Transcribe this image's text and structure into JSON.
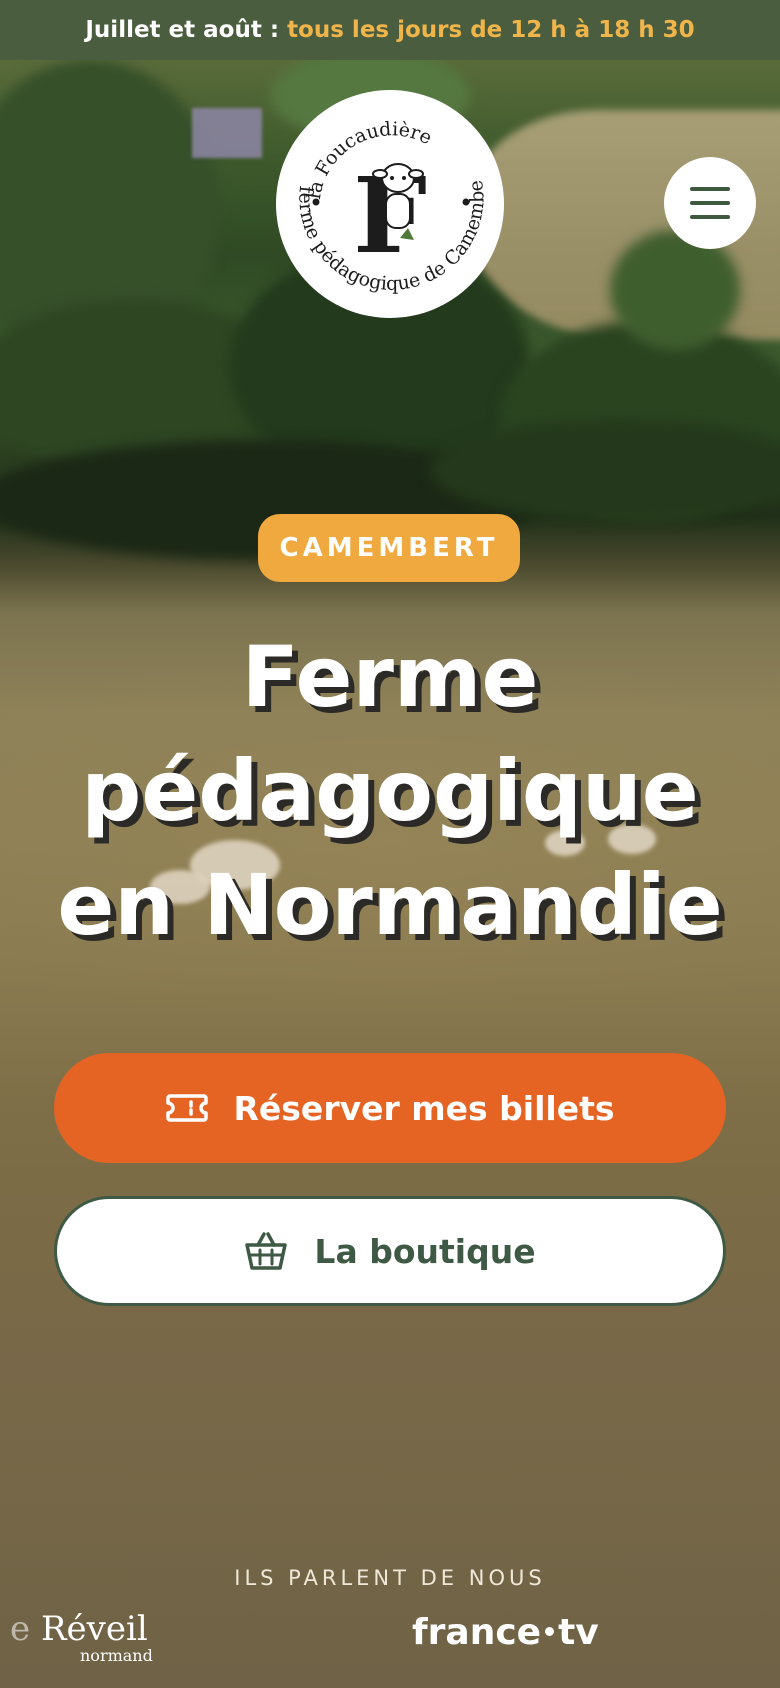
{
  "topbar": {
    "lead": "Juillet et août :",
    "highlight": "tous les jours de 12 h à 18 h 30"
  },
  "logo": {
    "alt": "la Foucaudière ferme pédagogique de Camembert",
    "arc_top": "la Foucaudière",
    "arc_bottom": "ferme pédagogique de Camembert",
    "letter": "F"
  },
  "hero": {
    "badge": "CAMEMBERT",
    "title_lines": [
      "Ferme",
      "pédagogique",
      "en Normandie"
    ]
  },
  "actions": {
    "primary_label": "Réserver mes billets",
    "secondary_label": "La boutique"
  },
  "press": {
    "label": "ILS PARLENT DE NOUS",
    "logos": [
      {
        "name": "Le Réveil normand",
        "main": "Réveil",
        "prefix": "e",
        "sub": "normand"
      },
      {
        "name": "france.tv",
        "left": "france",
        "right": "tv"
      }
    ]
  },
  "icons": {
    "menu": "hamburger-menu-icon",
    "ticket": "ticket-icon",
    "basket": "basket-icon"
  },
  "colors": {
    "topbar_bg": "#4a5d3f",
    "highlight": "#f0b54a",
    "badge_bg": "#efa93e",
    "primary_btn": "#e56424",
    "secondary_text": "#3f5a44"
  }
}
